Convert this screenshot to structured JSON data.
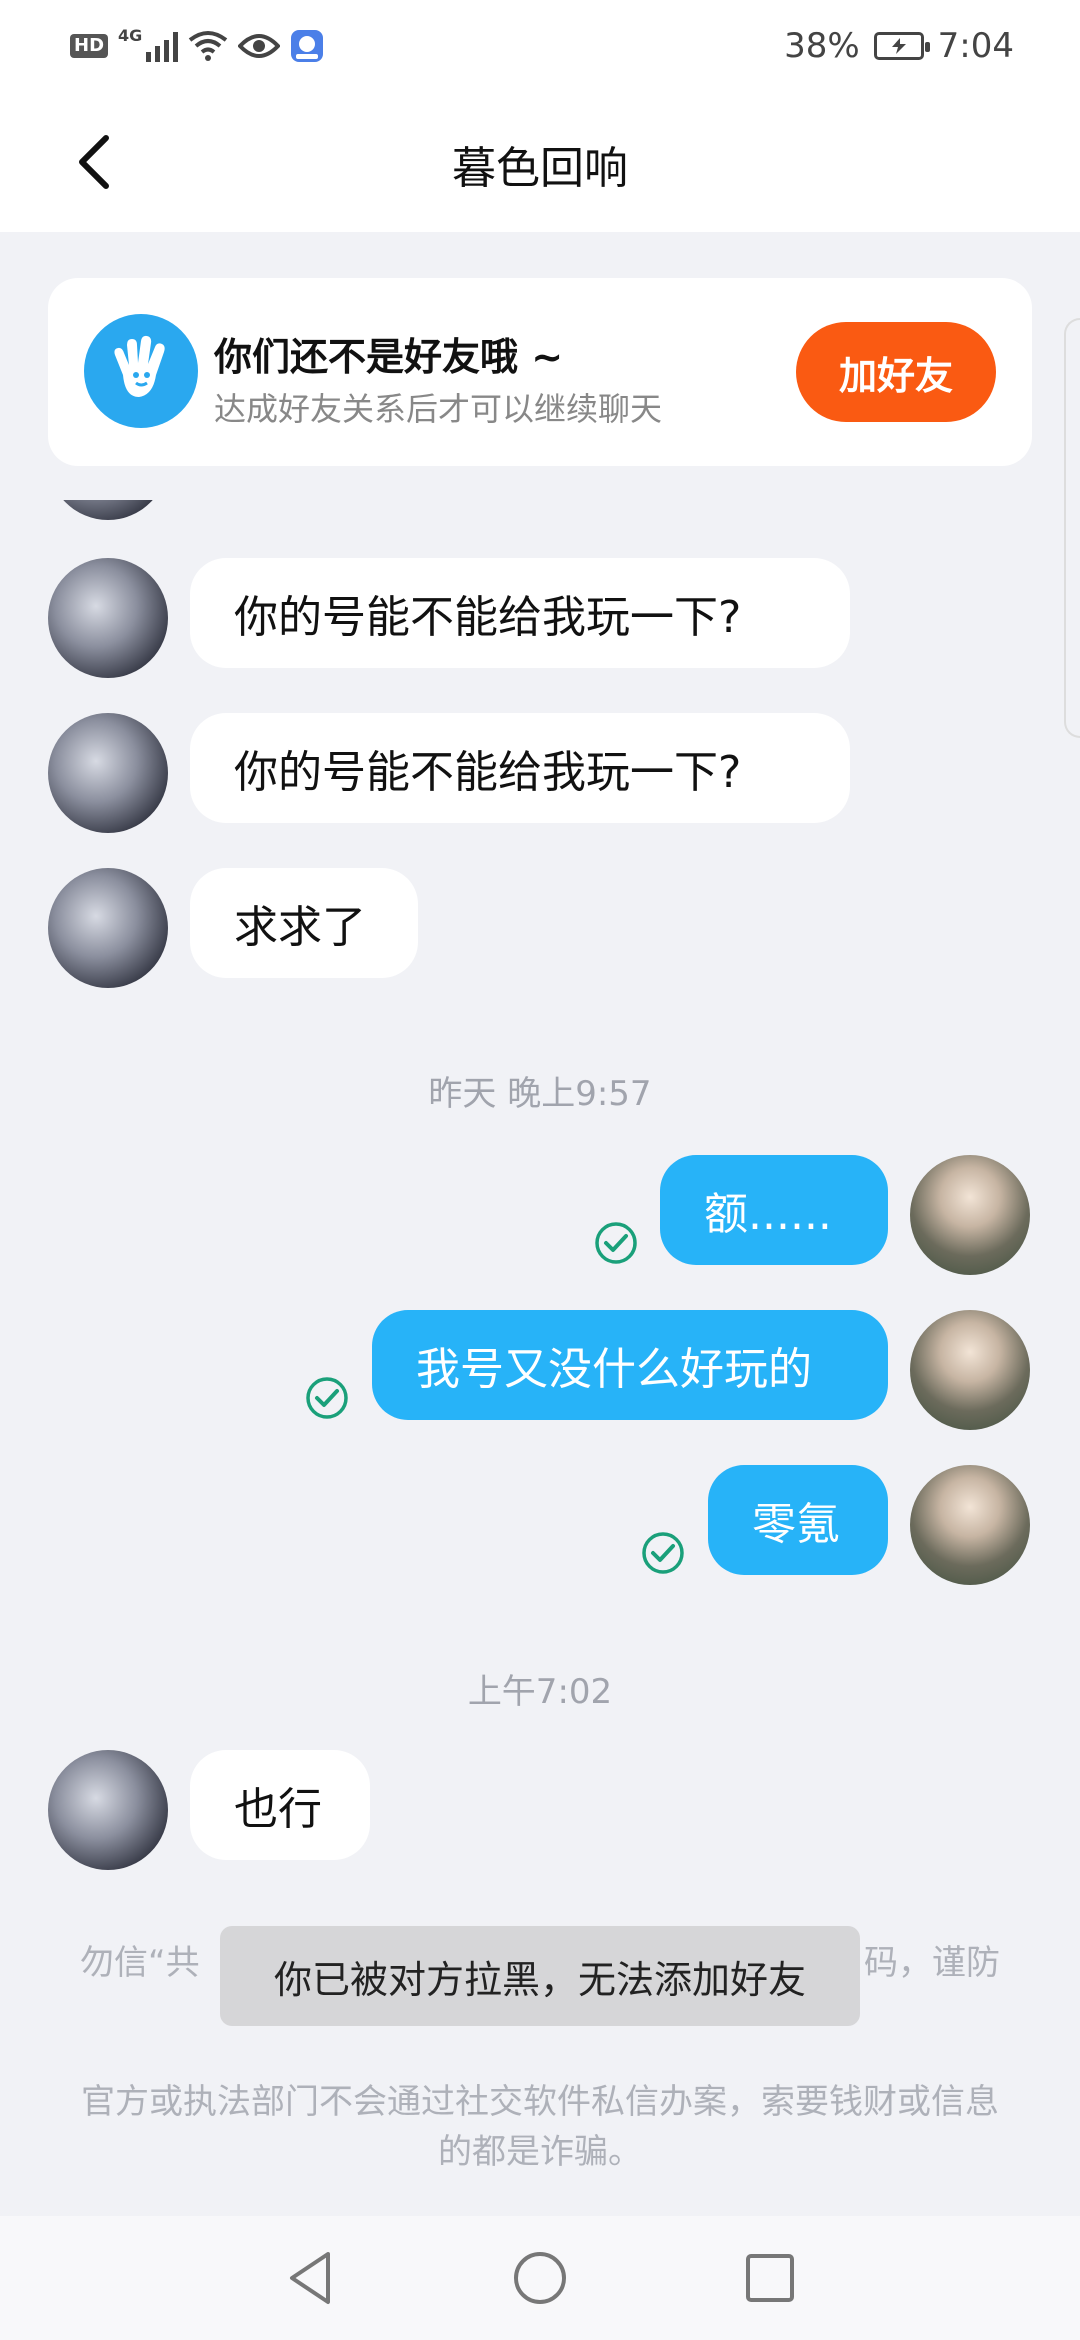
{
  "status_bar": {
    "hd_badge": "HD",
    "network": "4G",
    "battery_percent": "38%",
    "time": "7:04"
  },
  "header": {
    "title": "暮色回响"
  },
  "friend_banner": {
    "title": "你们还不是好友哦 ~",
    "subtitle": "达成好友关系后才可以继续聊天",
    "add_button": "加好友"
  },
  "messages": [
    {
      "side": "in",
      "text": "你的号能不能给我玩一下?"
    },
    {
      "side": "in",
      "text": "你的号能不能给我玩一下?"
    },
    {
      "side": "in",
      "text": "求求了"
    },
    {
      "type": "timestamp",
      "text": "昨天 晚上9:57"
    },
    {
      "side": "out",
      "text": "额......",
      "read": true
    },
    {
      "side": "out",
      "text": "我号又没什么好玩的",
      "read": true
    },
    {
      "side": "out",
      "text": "零氪",
      "read": true
    },
    {
      "type": "timestamp",
      "text": "上午7:02"
    },
    {
      "side": "in",
      "text": "也行"
    }
  ],
  "warning": {
    "line1_left": "勿信“共",
    "line1_right": "码，谨防",
    "line2": "官方或执法部门不会通过社交软件私信办案，索要钱财或信息的都是诈骗。"
  },
  "toast": "你已被对方拉黑，无法添加好友",
  "colors": {
    "accent_blue": "#27b3f8",
    "add_button_orange": "#fa5a12",
    "read_check_green": "#1aa07a"
  },
  "icons": {
    "back": "chevron-left-icon",
    "banner": "hand-wave-icon",
    "read": "check-circle-icon",
    "nav_back": "triangle-back-icon",
    "nav_home": "circle-home-icon",
    "nav_recent": "square-recent-icon"
  }
}
